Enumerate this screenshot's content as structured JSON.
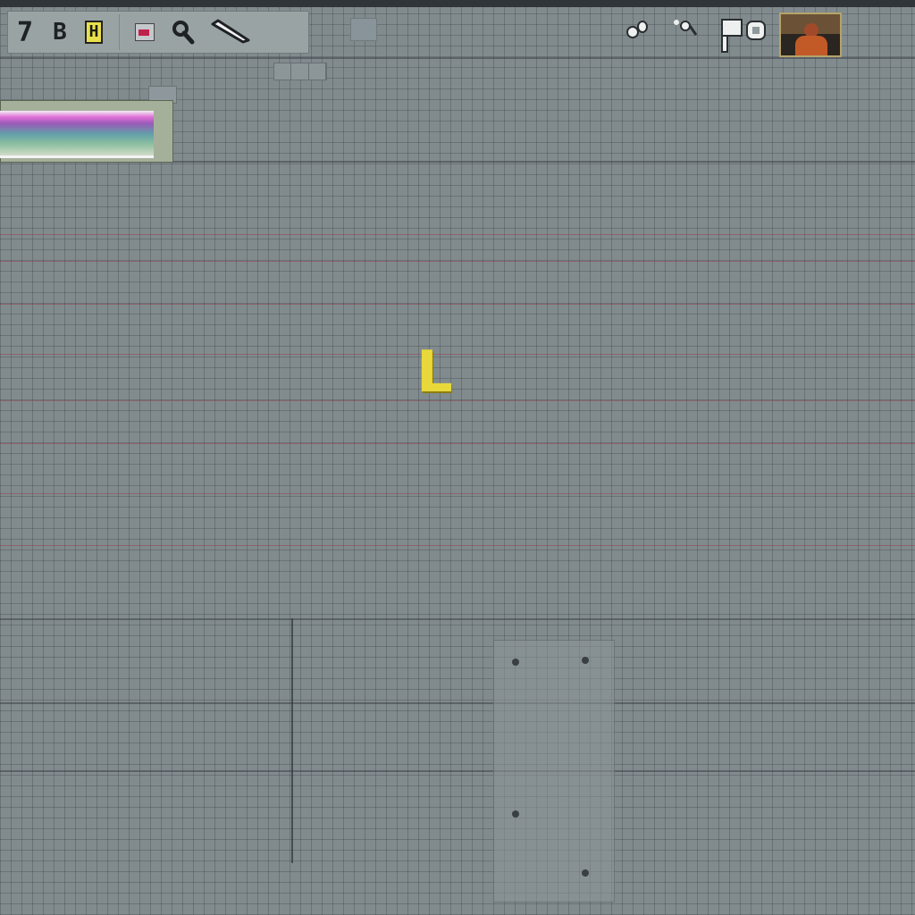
{
  "toolbar": {
    "btn_seven": "7",
    "btn_b": "B",
    "btn_h": "H"
  },
  "canvas": {
    "marker_letter": "L"
  },
  "icons": {
    "record": "record-icon",
    "search": "magnifier-icon",
    "pen": "pen-icon",
    "notes": "notes-icon",
    "eighth_note": "eighth-note-icon",
    "keyboard": "keyboard-icon",
    "thumbnail": "video-thumbnail-icon"
  },
  "colors": {
    "background": "#818b8e",
    "grid_red": "#96464f",
    "marker": "#e8d83a",
    "clip_pink": "#e070d8",
    "clip_teal": "#62a0a8"
  }
}
